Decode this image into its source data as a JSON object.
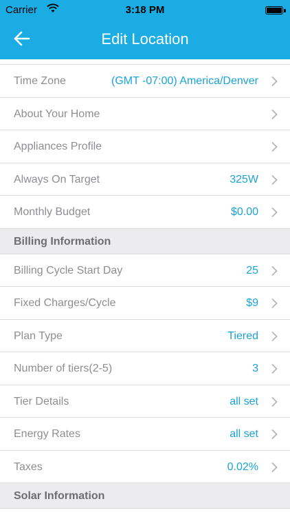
{
  "status_bar": {
    "carrier": "Carrier",
    "time": "3:18 PM"
  },
  "nav": {
    "title": "Edit Location",
    "back_icon": "arrow-left-icon"
  },
  "rows_top": [
    {
      "label": "Time Zone",
      "value": "(GMT -07:00) America/Denver"
    },
    {
      "label": "About Your Home",
      "value": ""
    },
    {
      "label": "Appliances Profile",
      "value": ""
    },
    {
      "label": "Always On Target",
      "value": "325W"
    },
    {
      "label": "Monthly Budget",
      "value": "$0.00"
    }
  ],
  "billing": {
    "title": "Billing Information",
    "rows": [
      {
        "label": "Billing Cycle Start Day",
        "value": "25"
      },
      {
        "label": "Fixed Charges/Cycle",
        "value": "$9"
      },
      {
        "label": "Plan Type",
        "value": "Tiered"
      },
      {
        "label": "Number of tiers(2-5)",
        "value": "3"
      },
      {
        "label": "Tier Details",
        "value": "all set"
      },
      {
        "label": "Energy Rates",
        "value": "all set"
      },
      {
        "label": "Taxes",
        "value": "0.02%"
      }
    ]
  },
  "solar": {
    "title": "Solar Information"
  },
  "colors": {
    "accent": "#1aace3",
    "value_text": "#1aa3d8",
    "label_text": "#8e8e93",
    "section_bg": "#ececee"
  }
}
